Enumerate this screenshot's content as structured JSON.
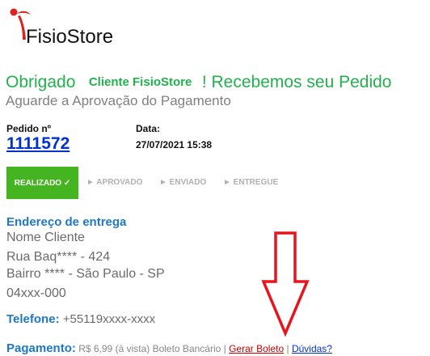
{
  "brand": {
    "name": "FisioStore"
  },
  "header": {
    "thanks_prefix": "Obrigado",
    "client_name": "Cliente FisioStore",
    "thanks_suffix": "! Recebemos seu Pedido",
    "subtitle": "Aguarde a Aprovação do Pagamento"
  },
  "order": {
    "label": "Pedido nº",
    "number": "1111572",
    "date_label": "Data:",
    "date_value": "27/07/2021 15:38"
  },
  "status_steps": [
    {
      "label": "REALIZADO ✓"
    },
    {
      "label": "► APROVADO"
    },
    {
      "label": "► ENVIADO"
    },
    {
      "label": "► ENTREGUE"
    }
  ],
  "shipping": {
    "title": "Endereço de entrega",
    "lines": [
      "Nome Cliente",
      "Rua Baq**** - 424",
      "Bairro  ****  - São Paulo - SP",
      "04xxx-000"
    ]
  },
  "phone": {
    "label": "Telefone:",
    "value": "+55119xxxx-xxxx"
  },
  "payment": {
    "label": "Pagamento:",
    "details": "R$ 6,99 (à vista) Boleto Bancário |",
    "boleto_link": "Gerar Boleto",
    "separator": "|",
    "help_link": "Dúvidas?"
  },
  "colors": {
    "green": "#22b14c",
    "step_active": "#44b520",
    "blue": "#1e78c8",
    "link_blue": "#0033cc",
    "red": "#cc0000",
    "gray": "#808080"
  },
  "icons": [
    "fisiostore-logo-icon",
    "red-down-arrow-annotation"
  ]
}
